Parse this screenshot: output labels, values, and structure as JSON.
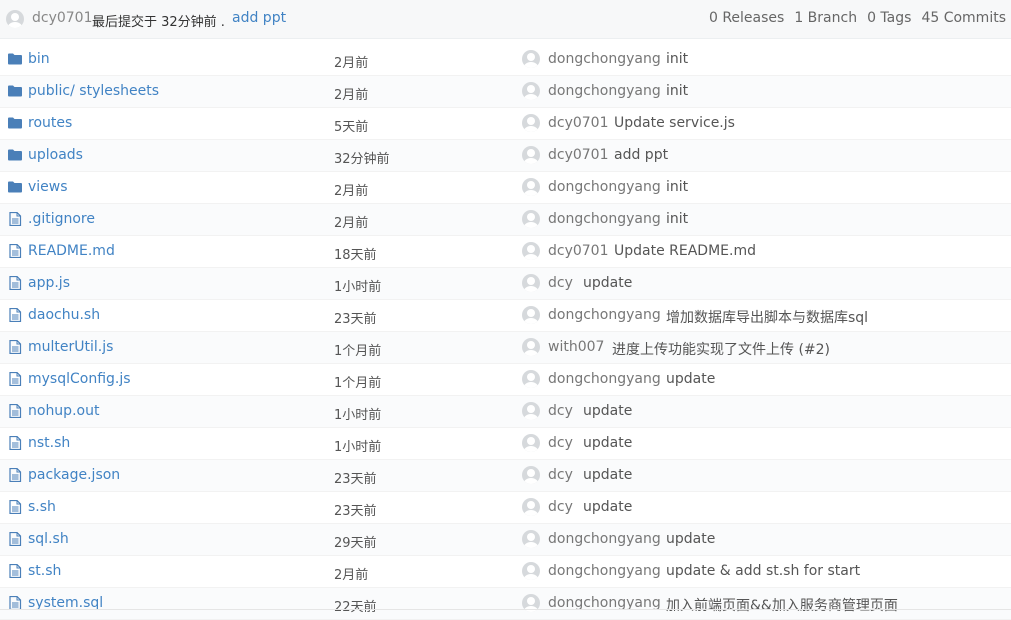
{
  "last_commit": {
    "user": "dcy0701",
    "info": "最后提交于 32分钟前 .",
    "message": "add ppt"
  },
  "stats": {
    "releases": "0 Releases",
    "branches": "1 Branch",
    "tags": "0 Tags",
    "commits": "45 Commits"
  },
  "files": [
    {
      "type": "folder",
      "name": "bin",
      "age": "2月前",
      "author": "dongchongyang",
      "message": "init"
    },
    {
      "type": "folder",
      "name": "public/ stylesheets",
      "age": "2月前",
      "author": "dongchongyang",
      "message": "init"
    },
    {
      "type": "folder",
      "name": "routes",
      "age": "5天前",
      "author": "dcy0701",
      "message": "Update service.js"
    },
    {
      "type": "folder",
      "name": "uploads",
      "age": "32分钟前",
      "author": "dcy0701",
      "message": "add ppt"
    },
    {
      "type": "folder",
      "name": "views",
      "age": "2月前",
      "author": "dongchongyang",
      "message": "init"
    },
    {
      "type": "file",
      "name": ".gitignore",
      "age": "2月前",
      "author": "dongchongyang",
      "message": "init"
    },
    {
      "type": "file",
      "name": "README.md",
      "age": "18天前",
      "author": "dcy0701",
      "message": "Update README.md"
    },
    {
      "type": "file",
      "name": "app.js",
      "age": "1小时前",
      "author": "dcy",
      "message": "update"
    },
    {
      "type": "file",
      "name": "daochu.sh",
      "age": "23天前",
      "author": "dongchongyang",
      "message": "增加数据库导出脚本与数据库sql"
    },
    {
      "type": "file",
      "name": "multerUtil.js",
      "age": "1个月前",
      "author": "with007",
      "message": "进度上传功能实现了文件上传 (#2)"
    },
    {
      "type": "file",
      "name": "mysqlConfig.js",
      "age": "1个月前",
      "author": "dongchongyang",
      "message": "update"
    },
    {
      "type": "file",
      "name": "nohup.out",
      "age": "1小时前",
      "author": "dcy",
      "message": "update"
    },
    {
      "type": "file",
      "name": "nst.sh",
      "age": "1小时前",
      "author": "dcy",
      "message": "update"
    },
    {
      "type": "file",
      "name": "package.json",
      "age": "23天前",
      "author": "dcy",
      "message": "update"
    },
    {
      "type": "file",
      "name": "s.sh",
      "age": "23天前",
      "author": "dcy",
      "message": "update"
    },
    {
      "type": "file",
      "name": "sql.sh",
      "age": "29天前",
      "author": "dongchongyang",
      "message": "update"
    },
    {
      "type": "file",
      "name": "st.sh",
      "age": "2月前",
      "author": "dongchongyang",
      "message": "update & add st.sh for start"
    },
    {
      "type": "file",
      "name": "system.sql",
      "age": "22天前",
      "author": "dongchongyang",
      "message": "加入前端页面&&加入服务商管理页面"
    }
  ],
  "colors": {
    "link": "#4183c4",
    "folder_icon": "#4a7fb8",
    "file_icon": "#4a7fb8"
  }
}
